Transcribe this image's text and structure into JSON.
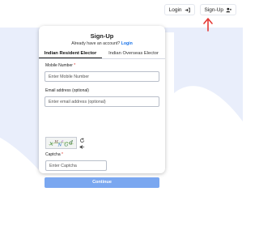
{
  "header": {
    "login_label": "Login",
    "signup_label": "Sign-Up",
    "login_icon": "login-icon",
    "signup_icon": "add-user-icon"
  },
  "annotation": {
    "icon": "red-arrow-up-icon",
    "color": "#e53935"
  },
  "signup": {
    "title": "Sign-Up",
    "account_prompt": "Already have an account?",
    "login_link": "Login",
    "tabs": [
      {
        "label": "Indian Resident Elector",
        "active": true
      },
      {
        "label": "Indian Overseas Elector",
        "active": false
      }
    ],
    "mobile": {
      "label": "Mobile Number",
      "required": "*",
      "placeholder": "Enter Mobile Number"
    },
    "email": {
      "label": "Email address (optional)",
      "placeholder": "Enter email address (optional)"
    },
    "captcha": {
      "image_text": "x^H^N-G^d",
      "refresh_icon": "refresh-icon",
      "audio_icon": "speaker-icon",
      "label": "Captcha",
      "required": "*",
      "placeholder": "Enter Captcha"
    },
    "continue_label": "Continue"
  },
  "colors": {
    "accent": "#1a73e8",
    "button": "#7aa7f0",
    "background_wave": "#e9eefb",
    "required": "#d93025"
  }
}
